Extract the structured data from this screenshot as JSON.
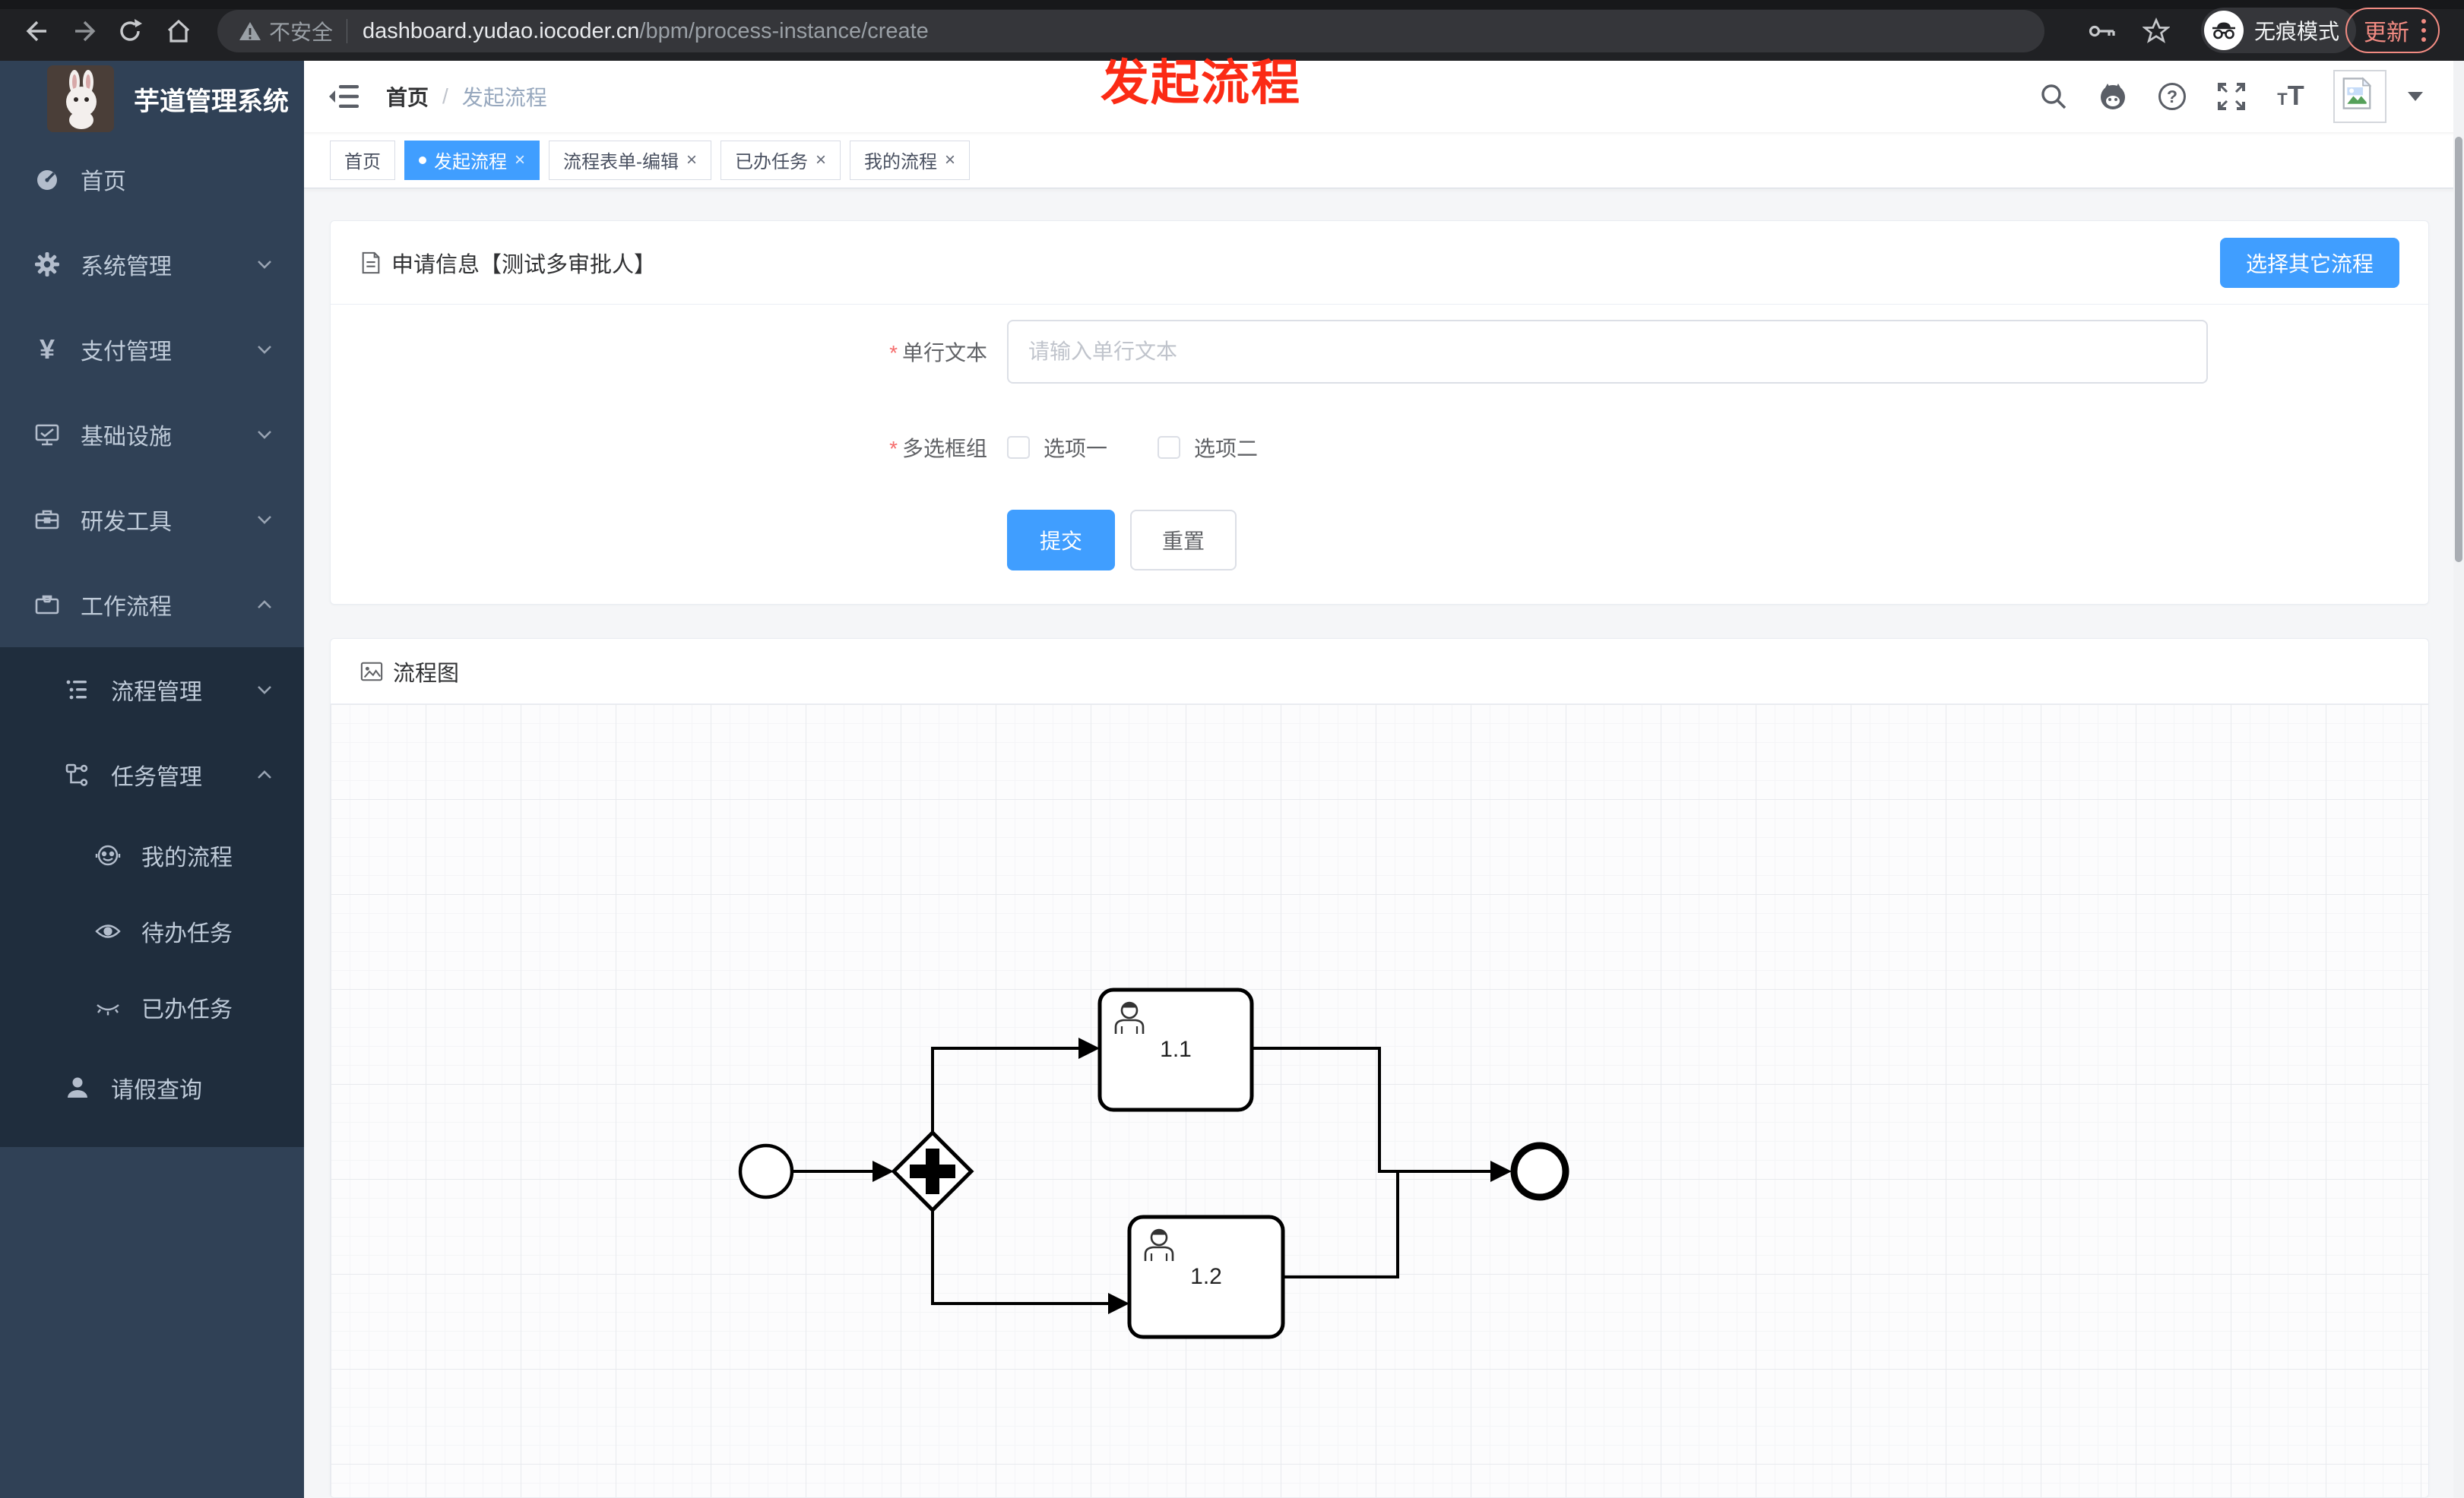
{
  "colors": {
    "accent": "#409eff",
    "annotation_red": "#fb2b15",
    "update_salmon": "#f28b82",
    "sidebar_bg": "#304156",
    "sidebar_submenu_bg": "#1f2d3d"
  },
  "browser": {
    "security_label": "不安全",
    "url_host": "dashboard.yudao.iocoder.cn",
    "url_path": "/bpm/process-instance/create",
    "incognito_label": "无痕模式",
    "update_label": "更新"
  },
  "annotation": {
    "text": "发起流程"
  },
  "sidebar": {
    "title": "芋道管理系统",
    "items": [
      {
        "label": "首页"
      },
      {
        "label": "系统管理"
      },
      {
        "label": "支付管理"
      },
      {
        "label": "基础设施"
      },
      {
        "label": "研发工具"
      },
      {
        "label": "工作流程"
      },
      {
        "label": "流程管理"
      },
      {
        "label": "任务管理"
      },
      {
        "label": "我的流程"
      },
      {
        "label": "待办任务"
      },
      {
        "label": "已办任务"
      },
      {
        "label": "请假查询"
      }
    ]
  },
  "navbar": {
    "breadcrumb_home": "首页",
    "breadcrumb_separator": "/",
    "breadcrumb_current": "发起流程",
    "font_icon_small": "T",
    "font_icon_large": "T"
  },
  "tabs": [
    {
      "label": "首页"
    },
    {
      "label": "发起流程"
    },
    {
      "label": "流程表单-编辑"
    },
    {
      "label": "已办任务"
    },
    {
      "label": "我的流程"
    }
  ],
  "form_card": {
    "title": "申请信息【测试多审批人】",
    "choose_button": "选择其它流程",
    "text_field": {
      "label": "单行文本",
      "placeholder": "请输入单行文本"
    },
    "checkbox_group": {
      "label": "多选框组",
      "options": [
        {
          "label": "选项一"
        },
        {
          "label": "选项二"
        }
      ]
    },
    "submit_label": "提交",
    "reset_label": "重置"
  },
  "diagram_card": {
    "title": "流程图",
    "tasks": [
      {
        "label": "1.1"
      },
      {
        "label": "1.2"
      }
    ]
  },
  "ui": {
    "close_glyph": "×",
    "yen": "¥"
  }
}
